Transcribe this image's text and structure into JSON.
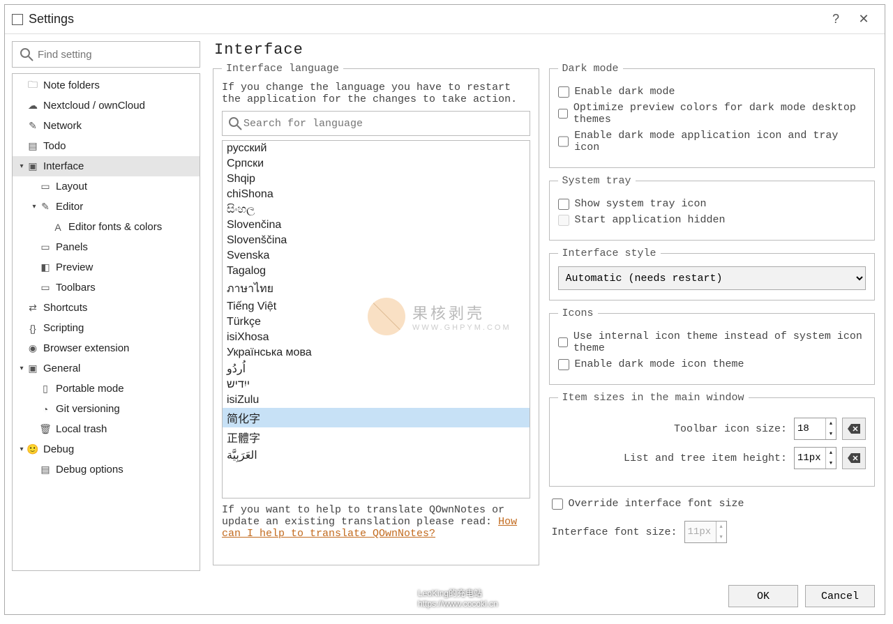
{
  "window": {
    "title": "Settings"
  },
  "search": {
    "placeholder": "Find setting"
  },
  "tree": [
    {
      "label": "Note folders",
      "indent": 1,
      "icon": "folder-icon"
    },
    {
      "label": "Nextcloud / ownCloud",
      "indent": 1,
      "icon": "cloud-icon"
    },
    {
      "label": "Network",
      "indent": 1,
      "icon": "network-icon"
    },
    {
      "label": "Todo",
      "indent": 1,
      "icon": "list-icon"
    },
    {
      "label": "Interface",
      "indent": 1,
      "icon": "interface-icon",
      "selected": true,
      "chevron": "▾"
    },
    {
      "label": "Layout",
      "indent": 2,
      "icon": "layout-icon"
    },
    {
      "label": "Editor",
      "indent": 2,
      "icon": "editor-icon",
      "chevron": "▾"
    },
    {
      "label": "Editor fonts & colors",
      "indent": 3,
      "icon": "fonts-icon"
    },
    {
      "label": "Panels",
      "indent": 2,
      "icon": "panels-icon"
    },
    {
      "label": "Preview",
      "indent": 2,
      "icon": "preview-icon"
    },
    {
      "label": "Toolbars",
      "indent": 2,
      "icon": "toolbars-icon"
    },
    {
      "label": "Shortcuts",
      "indent": 1,
      "icon": "shortcuts-icon"
    },
    {
      "label": "Scripting",
      "indent": 1,
      "icon": "scripting-icon"
    },
    {
      "label": "Browser extension",
      "indent": 1,
      "icon": "browser-icon"
    },
    {
      "label": "General",
      "indent": 1,
      "icon": "general-icon",
      "chevron": "▾"
    },
    {
      "label": "Portable mode",
      "indent": 2,
      "icon": "portable-icon"
    },
    {
      "label": "Git versioning",
      "indent": 2,
      "icon": "git-icon"
    },
    {
      "label": "Local trash",
      "indent": 2,
      "icon": "trash-icon"
    },
    {
      "label": "Debug",
      "indent": 1,
      "icon": "debug-icon",
      "chevron": "▾"
    },
    {
      "label": "Debug options",
      "indent": 2,
      "icon": "debug-options-icon"
    }
  ],
  "page": {
    "title": "Interface"
  },
  "lang": {
    "legend": "Interface language",
    "note": "If you change the language you have to restart the application for the changes to take action.",
    "search_placeholder": "Search for language",
    "items": [
      "русский",
      "Српски",
      "Shqip",
      "chiShona",
      "සිංහල",
      "Slovenčina",
      "Slovenščina",
      "Svenska",
      "Tagalog",
      "ภาษาไทย",
      "Tiếng Việt",
      "Türkçe",
      "isiXhosa",
      "Українська мова",
      "اُردُو",
      "ייִדיש",
      "isiZulu",
      "简化字",
      "正體字",
      "العَرَبِيَّة"
    ],
    "selected": "简化字",
    "help_prefix": "If you want to help to translate QOwnNotes or update an existing translation please read: ",
    "help_link": "How can I help to translate QOwnNotes?"
  },
  "dark": {
    "legend": "Dark mode",
    "c1": "Enable dark mode",
    "c2": "Optimize preview colors for dark mode desktop themes",
    "c3": "Enable dark mode application icon and tray icon"
  },
  "tray": {
    "legend": "System tray",
    "c1": "Show system tray icon",
    "c2": "Start application hidden"
  },
  "style": {
    "legend": "Interface style",
    "value": "Automatic (needs restart)"
  },
  "icons": {
    "legend": "Icons",
    "c1": "Use internal icon theme instead of system icon theme",
    "c2": "Enable dark mode icon theme"
  },
  "sizes": {
    "legend": "Item sizes in the main window",
    "toolbar_label": "Toolbar icon size:",
    "toolbar_value": "18",
    "list_label": "List and tree item height:",
    "list_value": "11px",
    "override_label": "Override interface font size",
    "font_label": "Interface font size:",
    "font_value": "11px"
  },
  "footer": {
    "ok": "OK",
    "cancel": "Cancel"
  },
  "watermark": {
    "line1": "果核剥壳",
    "line2": "WWW.GHPYM.COM"
  },
  "bottom_watermark": {
    "line1": "LeoKing的充电站",
    "line2": "https://www.cocokl.cn"
  }
}
